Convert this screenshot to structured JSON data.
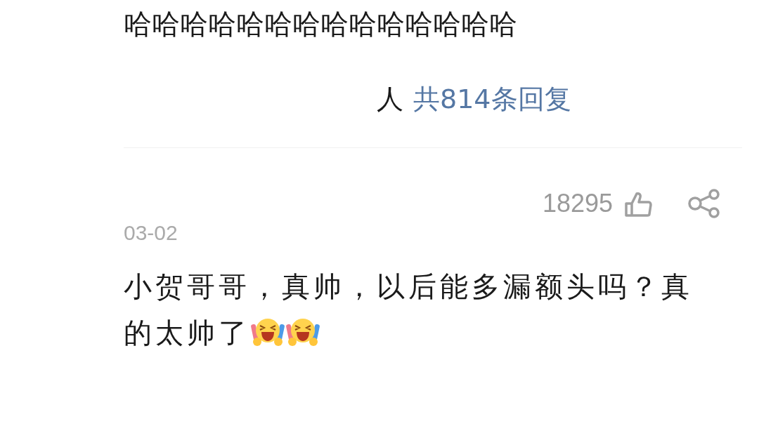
{
  "previous_comment": {
    "text": "哈哈哈哈哈哈哈哈哈哈哈哈哈哈",
    "reply_summary": {
      "name_fragment": "人",
      "count_link": "共814条回复"
    }
  },
  "comment": {
    "likes": "18295",
    "date": "03-02",
    "text": "小贺哥哥，真帅，以后能多漏额头吗？真的太帅了",
    "emojis": [
      {
        "kind": "laugh"
      },
      {
        "kind": "laugh"
      }
    ]
  }
}
